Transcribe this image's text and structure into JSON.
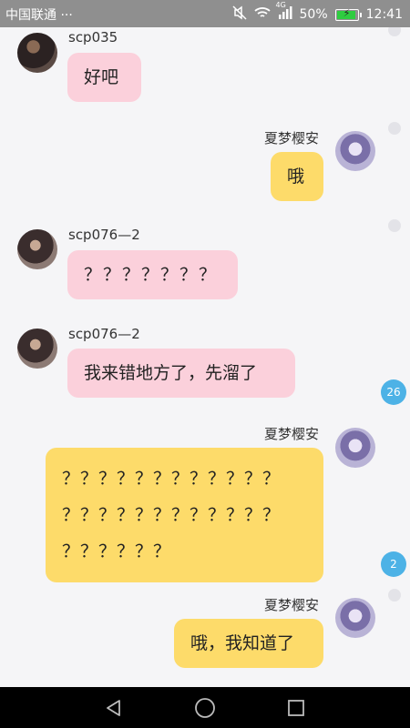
{
  "status_bar": {
    "carrier": "中国联通",
    "more": "···",
    "network": "4G",
    "battery": "50%",
    "time": "12:41",
    "battery_level": 0.5
  },
  "messages": [
    {
      "sender": "scp035",
      "text": "好吧",
      "side": "left"
    },
    {
      "sender": "夏梦樱安",
      "text": "哦",
      "side": "right"
    },
    {
      "sender": "scp076—2",
      "text": "？？？？？？？",
      "side": "left"
    },
    {
      "sender": "scp076—2",
      "text": "我来错地方了，先溜了",
      "side": "left",
      "badge": "26"
    },
    {
      "sender": "夏梦樱安",
      "lines": [
        "？？？？？？？？？？？？",
        "？？？？？？？？？？？？",
        "？？？？？？"
      ],
      "side": "right",
      "badge": "2"
    },
    {
      "sender": "夏梦樱安",
      "text": "哦，我知道了",
      "side": "right"
    }
  ],
  "colors": {
    "pink_bubble": "#fbd0db",
    "yellow_bubble": "#fddb6a",
    "badge": "#4db2e6",
    "status_bar": "#8f8f8f"
  }
}
